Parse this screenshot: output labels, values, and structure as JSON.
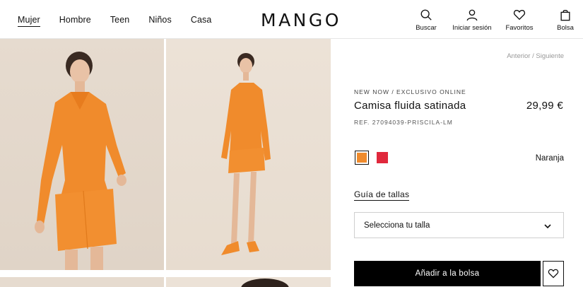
{
  "header": {
    "nav": [
      "Mujer",
      "Hombre",
      "Teen",
      "Niños",
      "Casa"
    ],
    "logo": "MANGO",
    "actions": {
      "search_label": "Buscar",
      "login_label": "Iniciar sesión",
      "favorites_label": "Favoritos",
      "bag_label": "Bolsa"
    }
  },
  "breadcrumb": {
    "prev": "Anterior",
    "sep": "/",
    "next": "Siguiente"
  },
  "product": {
    "tag": "NEW NOW / EXCLUSIVO ONLINE",
    "name": "Camisa fluida satinada",
    "price": "29,99 €",
    "ref": "REF. 27094039-PRISCILA-LM",
    "selected_color_name": "Naranja",
    "colors": [
      {
        "name": "Naranja",
        "hex": "#f08b2c",
        "selected": true
      },
      {
        "name": "Rojo",
        "hex": "#e0283c",
        "selected": false
      }
    ],
    "size_guide_label": "Guía de tallas",
    "size_select_placeholder": "Selecciona tu talla",
    "add_to_bag_label": "Añadir a la bolsa"
  },
  "theme": {
    "accent": "#000000",
    "garment": "#f08b2c"
  }
}
